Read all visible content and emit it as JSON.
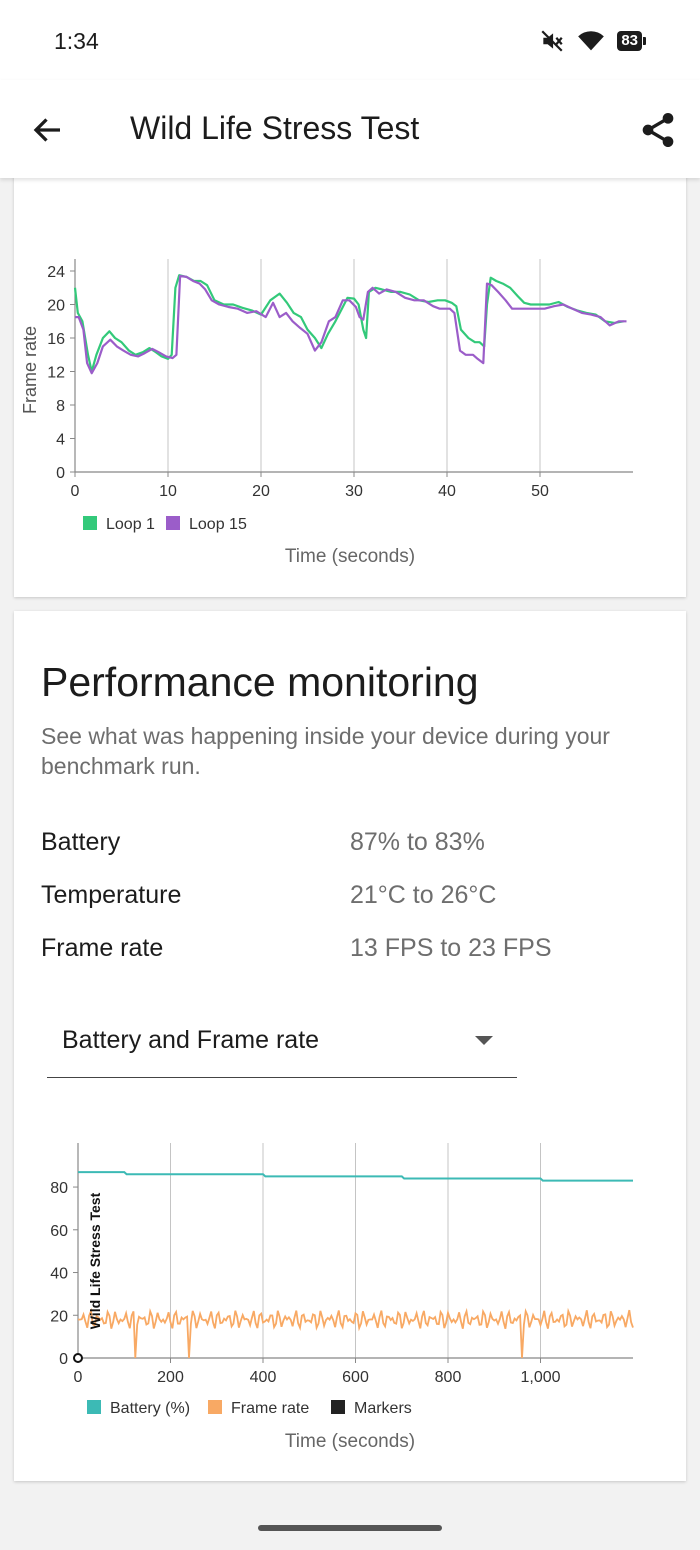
{
  "status_bar": {
    "time": "1:34",
    "battery_level": "83",
    "icons": [
      "mute-icon",
      "wifi-icon",
      "battery-icon"
    ]
  },
  "app_bar": {
    "title": "Wild Life Stress Test",
    "back_icon": "arrow-left-icon",
    "share_icon": "share-icon"
  },
  "performance": {
    "title": "Performance monitoring",
    "description": "See what was happening inside your device during your benchmark run.",
    "stats": [
      {
        "label": "Battery",
        "value": "87% to 83%"
      },
      {
        "label": "Temperature",
        "value": "21°C to 26°C"
      },
      {
        "label": "Frame rate",
        "value": "13 FPS to 23 FPS"
      }
    ],
    "dropdown": {
      "selected": "Battery and Frame rate"
    }
  },
  "colors": {
    "loop1": "#33c97a",
    "loop15": "#9b5dc9",
    "battery": "#3cbab5",
    "framerate": "#f8a964",
    "markers": "#222222"
  },
  "chart_data": [
    {
      "type": "line",
      "xlabel": "Time (seconds)",
      "ylabel": "Frame rate",
      "xlim": [
        0,
        60
      ],
      "ylim": [
        0,
        24
      ],
      "xticks": [
        0,
        10,
        20,
        30,
        40,
        50
      ],
      "yticks": [
        0,
        4,
        8,
        12,
        16,
        20,
        24
      ],
      "legend_position": "bottom-left",
      "series": [
        {
          "name": "Loop 1",
          "color": "#33c97a",
          "x": [
            0,
            0.3,
            0.8,
            1.4,
            1.8,
            2.3,
            3,
            3.7,
            4.3,
            5,
            5.8,
            6.5,
            7.3,
            8,
            8.7,
            9.3,
            10,
            10.4,
            10.8,
            11.2,
            12,
            12.8,
            13.5,
            14.2,
            15,
            16,
            17,
            18,
            19,
            20,
            21,
            22,
            22.8,
            23.5,
            24.3,
            25,
            25.8,
            26.5,
            27.2,
            28,
            28.7,
            29.3,
            30,
            30.5,
            31,
            31.3,
            31.6,
            32.3,
            33,
            34,
            35,
            36,
            37,
            38,
            39,
            39.8,
            40.5,
            41,
            41.5,
            42.3,
            43,
            43.5,
            44,
            44.3,
            44.7,
            45.3,
            46,
            46.8,
            47.6,
            48.3,
            49,
            50,
            51,
            52,
            53,
            54,
            55,
            56,
            57,
            58,
            59
          ],
          "y": [
            22,
            19,
            18,
            14,
            12,
            14,
            16,
            16.8,
            16,
            15.5,
            14.5,
            14,
            14.3,
            14.8,
            14.3,
            13.8,
            13.5,
            14,
            22,
            23.5,
            23.3,
            22.8,
            22.8,
            22.3,
            20.5,
            20,
            20,
            19.6,
            19.3,
            18.8,
            20.5,
            21.3,
            20.2,
            19,
            18.5,
            17,
            16,
            14.8,
            16.5,
            18,
            19.5,
            20.8,
            20.7,
            20,
            17,
            16,
            21.5,
            22,
            21.8,
            21.5,
            21.5,
            21.2,
            20.5,
            20.3,
            20.5,
            20.5,
            20.2,
            19.8,
            17,
            16,
            15.5,
            15.5,
            15,
            20,
            23.2,
            22.8,
            22.5,
            22,
            21,
            20.2,
            20,
            20,
            20,
            20.3,
            19.7,
            19.3,
            19,
            18.8,
            18,
            17.8,
            18
          ]
        },
        {
          "name": "Loop 15",
          "color": "#9b5dc9",
          "x": [
            0,
            0.4,
            0.9,
            1.3,
            1.8,
            2.4,
            3,
            3.8,
            4.5,
            5.2,
            6,
            6.8,
            7.5,
            8.3,
            9,
            9.8,
            10.5,
            10.9,
            11.3,
            12,
            12.7,
            13.4,
            14,
            14.7,
            15.5,
            16.5,
            17.5,
            18.5,
            19.5,
            20.5,
            21.3,
            22,
            22.7,
            23.4,
            24.2,
            25,
            25.8,
            26.5,
            27.3,
            28,
            28.8,
            29.5,
            30.2,
            30.6,
            31,
            31.5,
            32,
            32.7,
            33.5,
            34.5,
            35.5,
            36.5,
            37.5,
            38.5,
            39.2,
            39.8,
            40.3,
            40.8,
            41.4,
            42,
            42.8,
            43.3,
            43.9,
            44.3,
            44.8,
            45.5,
            46.3,
            47,
            47.8,
            48.6,
            49.5,
            50.5,
            51.5,
            52.5,
            53.5,
            54.5,
            55.5,
            56.5,
            57.5,
            58.5,
            59.3
          ],
          "y": [
            18.5,
            18.5,
            17,
            13,
            11.8,
            13,
            15,
            15.8,
            15,
            14.5,
            14,
            13.8,
            14.2,
            14.7,
            14.3,
            13.8,
            13.6,
            14,
            23.4,
            23.3,
            22.8,
            22.5,
            21.8,
            20.5,
            20,
            19.7,
            19.5,
            19,
            19.2,
            18.5,
            20.2,
            18.5,
            19,
            18,
            17.2,
            16.5,
            14.5,
            15.5,
            18,
            18.5,
            20.5,
            20.5,
            19.7,
            18.5,
            18.2,
            21.5,
            22,
            21.3,
            21.8,
            21.5,
            20.8,
            20.5,
            20.5,
            19.8,
            19.5,
            19.5,
            19.5,
            19,
            14.5,
            14,
            14,
            13.5,
            13,
            22.5,
            22.3,
            21.5,
            20.5,
            19.5,
            19.5,
            19.5,
            19.5,
            19.5,
            19.8,
            20,
            19.5,
            19,
            18.8,
            18.5,
            17.5,
            18,
            18
          ]
        }
      ]
    },
    {
      "type": "line",
      "xlabel": "Time (seconds)",
      "xlim": [
        0,
        1200
      ],
      "ylim": [
        0,
        95
      ],
      "xticks": [
        0,
        200,
        400,
        600,
        800,
        1000
      ],
      "xtick_labels": [
        "0",
        "200",
        "400",
        "600",
        "800",
        "1,000"
      ],
      "yticks": [
        0,
        20,
        40,
        60,
        80
      ],
      "legend_position": "bottom-left",
      "annotation": {
        "text": "Wild Life Stress Test",
        "x": 0
      },
      "series": [
        {
          "name": "Battery (%)",
          "color": "#3cbab5",
          "x": [
            0,
            100,
            105,
            400,
            405,
            700,
            705,
            1000,
            1005,
            1200
          ],
          "y": [
            87,
            87,
            86,
            86,
            85,
            85,
            84,
            84,
            83,
            83
          ]
        },
        {
          "name": "Frame rate",
          "color": "#f8a964",
          "x": [
            0,
            120,
            122,
            126,
            237,
            239,
            243,
            955,
            957,
            961,
            1200
          ],
          "y": [
            18,
            18,
            18,
            0,
            18,
            18,
            0,
            18,
            18,
            0,
            18
          ],
          "range": [
            13,
            23
          ]
        },
        {
          "name": "Markers",
          "color": "#222222",
          "x": [
            0
          ],
          "y": [
            0
          ]
        }
      ]
    }
  ]
}
